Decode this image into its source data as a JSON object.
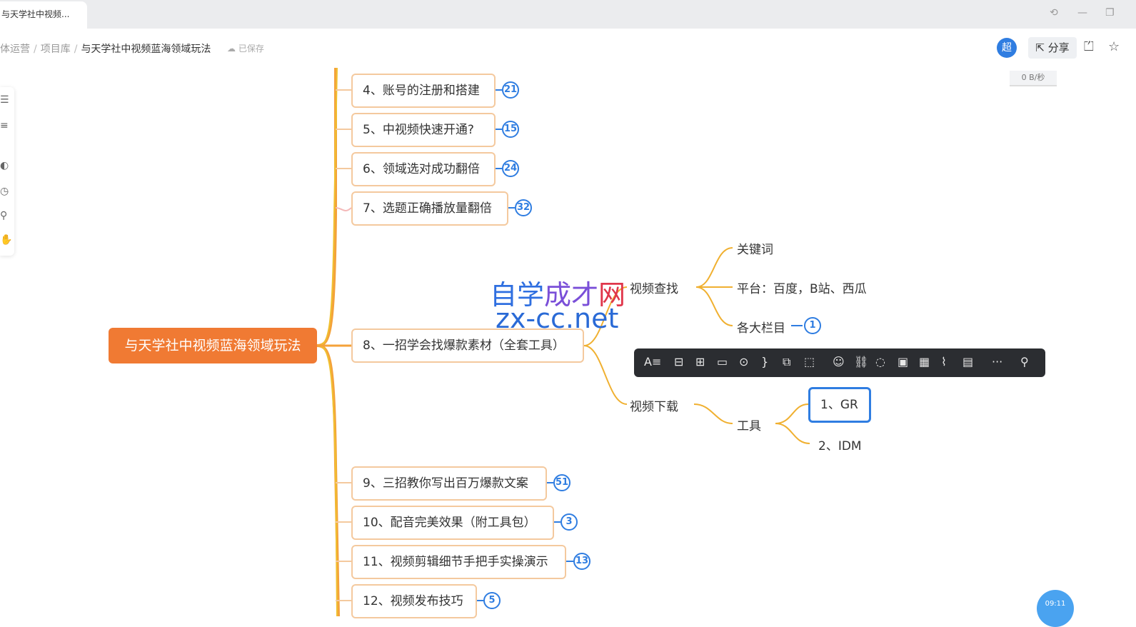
{
  "tab": {
    "title": "与天学社中视频..."
  },
  "breadcrumb": {
    "items": [
      "体运营",
      "项目库",
      "与天学社中视频蓝海领域玩法"
    ],
    "saved": "已保存"
  },
  "header": {
    "avatar": "超",
    "share_label": "分享",
    "speed": "0 B/秒"
  },
  "mindmap": {
    "root": "与天学社中视频蓝海领域玩法",
    "branches": [
      {
        "label": "4、账号的注册和搭建",
        "count": "21"
      },
      {
        "label": "5、中视频快速开通?",
        "count": "15"
      },
      {
        "label": "6、领域选对成功翻倍",
        "count": "24"
      },
      {
        "label": "7、选题正确播放量翻倍",
        "count": "32"
      },
      {
        "label": "8、一招学会找爆款素材（全套工具）"
      },
      {
        "label": "9、三招教你写出百万爆款文案",
        "count": "51"
      },
      {
        "label": "10、配音完美效果（附工具包）",
        "count": "3"
      },
      {
        "label": "11、视频剪辑细节手把手实操演示",
        "count": "13"
      },
      {
        "label": "12、视频发布技巧",
        "count": "5"
      }
    ],
    "sub": {
      "find": "视频查找",
      "keywords": "关键词",
      "platforms": "平台：百度，B站、西瓜",
      "columns": "各大栏目",
      "columns_count": "1",
      "download": "视频下载",
      "tools": "工具",
      "tool1": "1、GR",
      "tool2": "2、IDM"
    }
  },
  "watermark": {
    "line1_a": "自学",
    "line1_b": "成才",
    "line1_c": "网",
    "line2": "zx-cc.net"
  },
  "toolbar": {
    "icons": [
      "text-style-icon",
      "insert-child-icon",
      "insert-sibling-icon",
      "relationship-icon",
      "target-icon",
      "summary-icon",
      "structure-icon",
      "frame-icon",
      "emoji-icon",
      "link-icon",
      "comment-icon",
      "image-icon",
      "calendar-icon",
      "attachment-icon",
      "note-icon",
      "more-icon",
      "pin-icon"
    ]
  },
  "bubble": {
    "time": "09:11"
  },
  "colors": {
    "root": "#f07a33",
    "accent": "#2f7de1",
    "node_border": "#f4c99e",
    "toolbar": "#2b2d31"
  }
}
